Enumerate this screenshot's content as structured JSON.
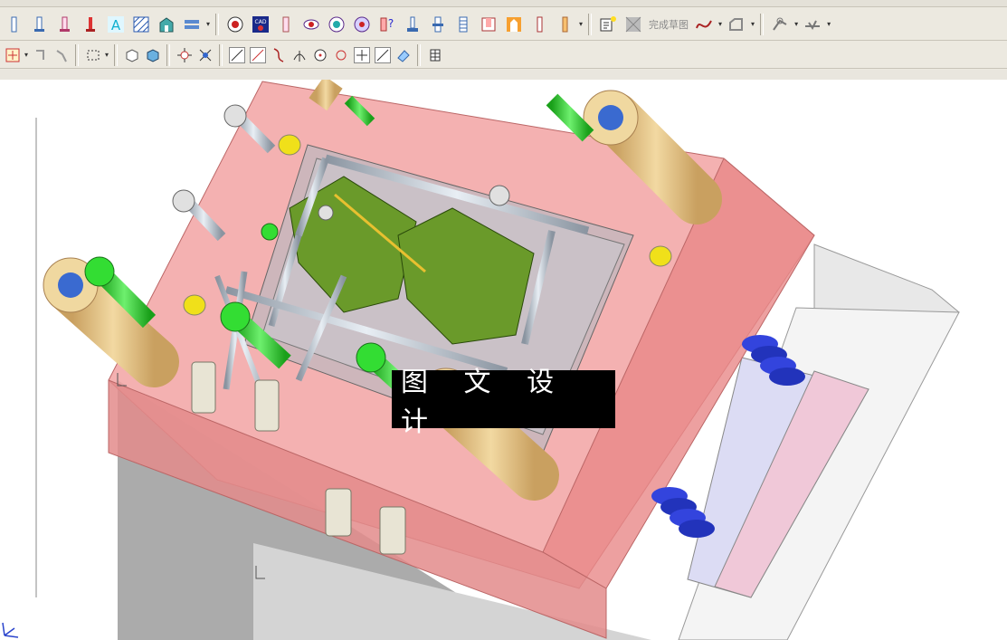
{
  "toolbar_row1": {
    "finish_sketch_label": "完成草图",
    "icons": [
      "line-icon",
      "pin-icon",
      "pin-icon",
      "text-icon",
      "hatch-icon",
      "house-icon",
      "list-icon",
      "target-icon",
      "cad-icon",
      "pin-icon",
      "eye-icon",
      "eye-icon",
      "disc-icon",
      "help-icon",
      "pin-icon",
      "pin-icon",
      "pin-icon",
      "gate-icon",
      "fire-icon",
      "pin-icon",
      "bar-icon"
    ]
  },
  "toolbar_row2": {
    "icons": [
      "snap-icon",
      "hook-icon",
      "hook-icon",
      "box-select-icon",
      "cube-icon",
      "cube-icon",
      "node-icon",
      "node-icon",
      "line-tool-icon",
      "line-tool-icon",
      "curve-icon",
      "arc-icon",
      "circle-icon",
      "point-icon",
      "cross-icon",
      "slash-icon",
      "arrow-icon",
      "grid-icon"
    ]
  },
  "viewport": {
    "watermark_text": "图 文 设 计",
    "colors": {
      "plate": "#ee9a9a",
      "plate_dark": "#d77a7a",
      "steel": "#dcdcdc",
      "bushing": "#e8c98a",
      "screw": "#33dd33",
      "core": "#6a9a2a",
      "spring": "#3344dd",
      "pin": "#c0c8d2"
    }
  }
}
